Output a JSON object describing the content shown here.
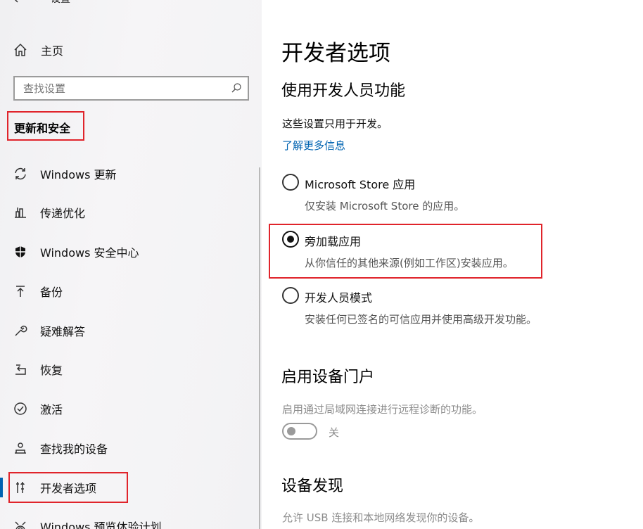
{
  "window": {
    "title": "设置"
  },
  "sidebar": {
    "home_label": "主页",
    "search_placeholder": "查找设置",
    "section_title": "更新和安全",
    "items": [
      {
        "label": "Windows 更新",
        "icon": "sync-icon"
      },
      {
        "label": "传递优化",
        "icon": "delivery-icon"
      },
      {
        "label": "Windows 安全中心",
        "icon": "shield-icon"
      },
      {
        "label": "备份",
        "icon": "backup-arrow-icon"
      },
      {
        "label": "疑难解答",
        "icon": "wrench-icon"
      },
      {
        "label": "恢复",
        "icon": "recovery-icon"
      },
      {
        "label": "激活",
        "icon": "check-circle-icon"
      },
      {
        "label": "查找我的设备",
        "icon": "person-device-icon"
      },
      {
        "label": "开发者选项",
        "icon": "developer-tools-icon",
        "active": true
      },
      {
        "label": "Windows 预览体验计划",
        "icon": "insider-icon"
      }
    ]
  },
  "main": {
    "title": "开发者选项",
    "section1": {
      "heading": "使用开发人员功能",
      "desc": "这些设置只用于开发。",
      "link": "了解更多信息",
      "options": [
        {
          "label": "Microsoft Store 应用",
          "desc": "仅安装 Microsoft Store 的应用。",
          "checked": false
        },
        {
          "label": "旁加载应用",
          "desc": "从你信任的其他来源(例如工作区)安装应用。",
          "checked": true
        },
        {
          "label": "开发人员模式",
          "desc": "安装任何已签名的可信应用并使用高级开发功能。",
          "checked": false
        }
      ]
    },
    "section2": {
      "heading": "启用设备门户",
      "desc": "启用通过局域网连接进行远程诊断的功能。",
      "toggle_label": "关"
    },
    "section3": {
      "heading": "设备发现",
      "desc": "允许 USB 连接和本地网络发现你的设备。"
    }
  },
  "colors": {
    "accent": "#0063b1",
    "highlight": "#e0242b"
  }
}
